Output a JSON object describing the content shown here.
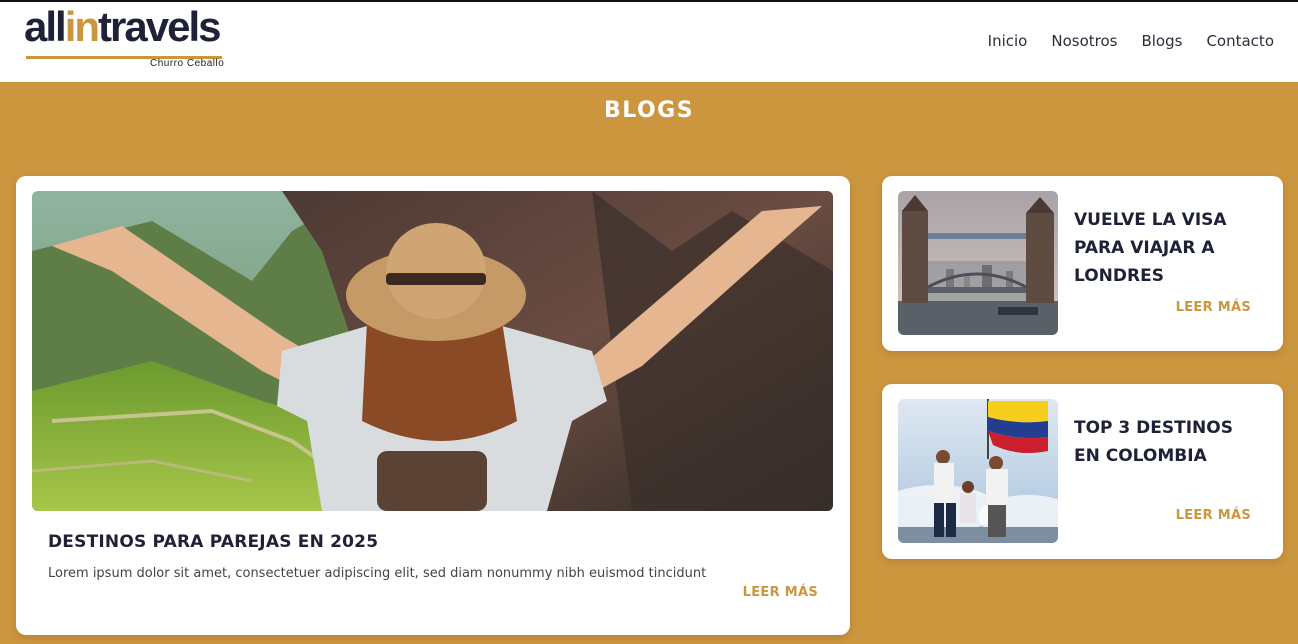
{
  "brand": {
    "logo_part1": "all",
    "logo_part2": "in",
    "logo_part3": "travels",
    "logo_sub": "Churro Ceballo",
    "accent_color": "#cc963e",
    "dark_color": "#1f2236"
  },
  "nav": {
    "items": [
      {
        "label": "Inicio"
      },
      {
        "label": "Nosotros"
      },
      {
        "label": "Blogs"
      },
      {
        "label": "Contacto"
      }
    ]
  },
  "section": {
    "title": "BLOGS"
  },
  "featured_post": {
    "image": "woman-with-hat-arms-raised-machu-picchu",
    "title": "DESTINOS PARA PAREJAS EN 2025",
    "excerpt": "Lorem ipsum dolor sit amet, consectetuer adipiscing elit, sed diam nonummy nibh euismod tincidunt u...",
    "read_more": "LEER MÁS"
  },
  "side_posts": [
    {
      "image": "tower-bridge-london",
      "title": "VUELVE LA VISA PARA VIAJAR A LONDRES",
      "read_more": "LEER MÁS"
    },
    {
      "image": "travelers-with-colombian-flag",
      "title": "TOP 3 DESTINOS EN COLOMBIA",
      "read_more": "LEER MÁS"
    }
  ]
}
